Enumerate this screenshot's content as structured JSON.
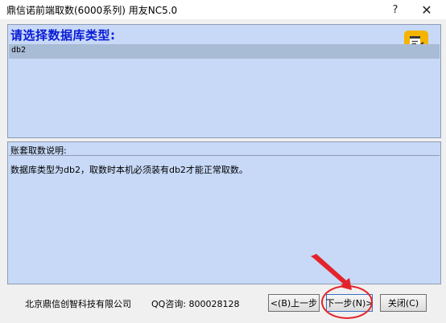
{
  "window": {
    "title": "鼎信诺前端取数(6000系列)  用友NC5.0",
    "help_glyph": "?",
    "close_glyph": "✕"
  },
  "db_panel": {
    "heading": "请选择数据库类型:",
    "items": [
      {
        "label": "db2",
        "selected": true
      }
    ],
    "icon": "note-edit-icon",
    "icon_color": "#f4b400",
    "background": "#c7d9f7",
    "selected_row_color": "#a9bcd6",
    "heading_color": "#0a1bd6"
  },
  "desc_panel": {
    "label": "账套取数说明:",
    "text": "数据库类型为db2，取数时本机必须装有db2才能正常取数。"
  },
  "footer": {
    "company": "北京鼎信创智科技有限公司",
    "qq": "QQ咨询: 800028128",
    "prev_label": "<(B)上一步",
    "next_label": "下一步(N)>",
    "close_label": "关闭(C)"
  },
  "annotation": {
    "color": "#e3242b"
  }
}
